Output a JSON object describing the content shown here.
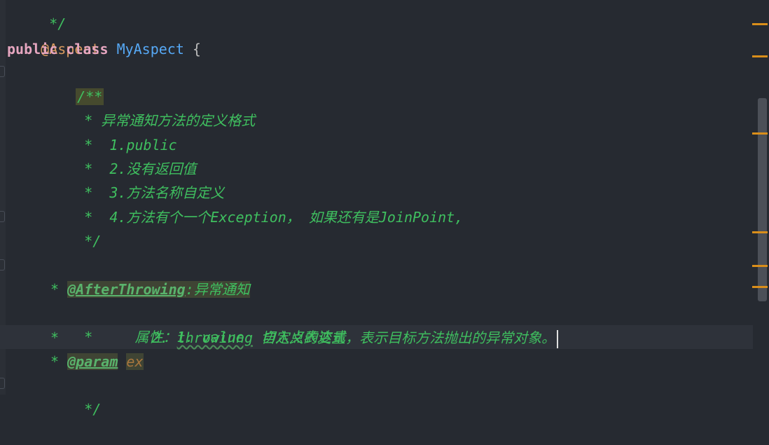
{
  "code": {
    "line0": " */",
    "line1_annotation": "@Aspect",
    "line2_public": "public",
    "line2_class": "class",
    "line2_name": "MyAspect",
    "line2_brace": " {",
    "line3": "/**",
    "line4": " * 异常通知方法的定义格式",
    "line5": " *  1.public",
    "line6": " *  2.没有返回值",
    "line7": " *  3.方法名称自定义",
    "line8": " *  4.方法有个一个Exception， 如果还有是JoinPoint,",
    "line9": " */",
    "line11": "/**",
    "line12_star": " * ",
    "line12_tag": "@AfterThrowing",
    "line12_text": ":异常通知",
    "line13": " *     属性：1. value  切入点表达式",
    "line14_pre": " *           2. ",
    "line14_typo": "throwinng",
    "line14_post": " 自定义的变量，表示目标方法抛出的异常对象。",
    "line15_star": " * ",
    "line15_tag": "@param",
    "line15_param": "ex",
    "line16": " */"
  },
  "colors": {
    "background": "#262a31",
    "annotation": "#d99a5e",
    "keyword": "#e6a6c0",
    "class_name": "#56a8f5",
    "comment": "#3fbf5f",
    "marker": "#d98e1a"
  }
}
